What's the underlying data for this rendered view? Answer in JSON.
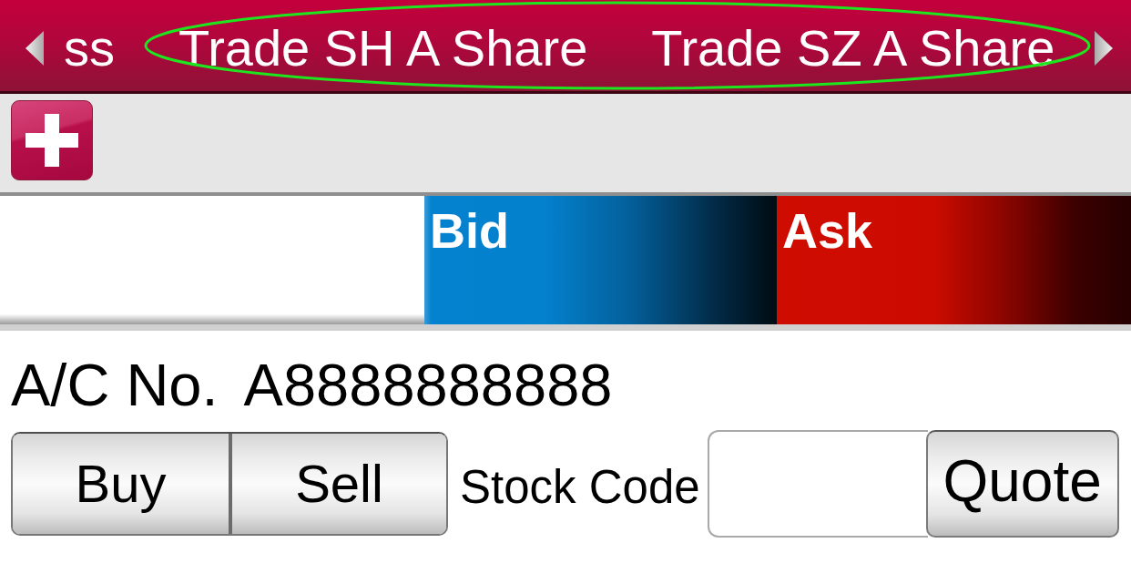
{
  "tab_bar": {
    "tabs": [
      {
        "label": "ss"
      },
      {
        "label": "Trade SH A Share"
      },
      {
        "label": "Trade SZ A Share"
      }
    ]
  },
  "annotation": {
    "kind": "ellipse"
  },
  "quote_header": {
    "columns": [
      {
        "kind": "bid",
        "label": "Bid"
      },
      {
        "kind": "ask",
        "label": "Ask"
      }
    ]
  },
  "account": {
    "label": "A/C No.",
    "value": "A8888888888"
  },
  "order_form": {
    "side_buttons": [
      {
        "label": "Buy"
      },
      {
        "label": "Sell"
      }
    ],
    "stock_code": {
      "label": "Stock Code"
    },
    "quote_button": "Quote"
  }
}
